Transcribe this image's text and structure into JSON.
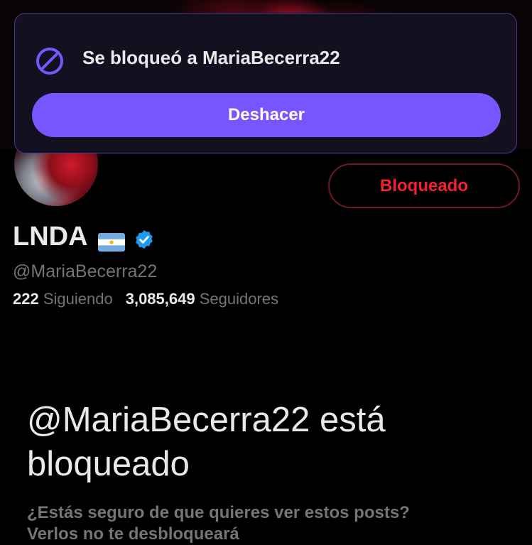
{
  "toast": {
    "message": "Se bloqueó a MariaBecerra22",
    "undo_label": "Deshacer"
  },
  "profile": {
    "blocked_button_label": "Bloqueado",
    "display_name": "LNDA",
    "handle": "@MariaBecerra22",
    "following_count": "222",
    "following_label": "Siguiendo",
    "followers_count": "3,085,649",
    "followers_label": "Seguidores"
  },
  "blocked_notice": {
    "title": "@MariaBecerra22 está bloqueado",
    "subtitle_line1": "¿Estás seguro de que quieres ver estos posts?",
    "subtitle_line2": "Verlos no ​​te ​​desbloqueará"
  },
  "colors": {
    "accent": "#7856ff",
    "blocked_red": "#f4212e",
    "verified_blue": "#1d9bf0"
  },
  "icons": [
    "block-icon",
    "argentina-flag-icon",
    "verified-badge-icon"
  ]
}
